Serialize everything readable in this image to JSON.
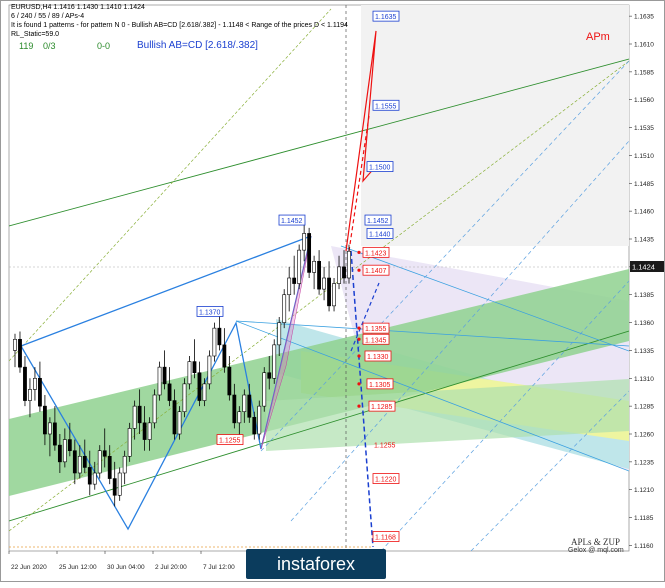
{
  "header": {
    "symbol_line": "EURUSD,H4  1.1416 1.1430 1.1410 1.1424",
    "indicator_line": "6 / 240 / 55 / 89 / APs-4",
    "pattern_line": "It is found 1 patterns  -  for pattern N 0 - Bullish AB=CD [2.618/.382] - 1.1148 < Range of the prices D < 1.1194",
    "static_line": "RL_Static=59.0",
    "count_a": "119",
    "count_b": "0/3",
    "count_c": "0-0",
    "pattern_name": "Bullish AB=CD [2.618/.382]"
  },
  "brand": {
    "apm": "APm",
    "credit_1": "APLs & ZUP",
    "credit_2": "Gelox @ mql.com",
    "watermark": "instaforex"
  },
  "price_axis": {
    "ticks": [
      "1.1635",
      "1.1610",
      "1.1585",
      "1.1560",
      "1.1535",
      "1.1510",
      "1.1485",
      "1.1460",
      "1.1435",
      "1.1410",
      "1.1385",
      "1.1360",
      "1.1335",
      "1.1310",
      "1.1285",
      "1.1260",
      "1.1235",
      "1.1210",
      "1.1185",
      "1.1160"
    ],
    "current": "1.1424"
  },
  "time_axis": {
    "ticks": [
      "22 Jun 2020",
      "25 Jun 12:00",
      "30 Jun 04:00",
      "2 Jul 20:00",
      "7 Jul 12:00"
    ]
  },
  "labels": {
    "blue": [
      "1.1635",
      "1.1555",
      "1.1500",
      "1.1452",
      "1.1440",
      "1.1452",
      "1.1370"
    ],
    "red": [
      "1.1423",
      "1.1407",
      "1.1355",
      "1.1345",
      "1.1330",
      "1.1305",
      "1.1285",
      "1.1220",
      "1.1168",
      "1.1255"
    ],
    "plain": [
      "1.1255"
    ]
  },
  "colors": {
    "accent_red": "#e11",
    "accent_blue": "#1a3fd0",
    "zone_green": "#5ab45a",
    "zone_yellow": "#f0f080",
    "zone_cyan": "#9fd8e0",
    "zone_lavender": "#ece6f6"
  },
  "chart_data": {
    "type": "candlestick",
    "title": "EURUSD,H4",
    "ylim": [
      1.1155,
      1.1645
    ],
    "x_range": [
      "22 Jun 2020",
      "7 Jul 12:00"
    ],
    "ohlc": [
      [
        1.1335,
        1.135,
        1.132,
        1.1345
      ],
      [
        1.1345,
        1.1352,
        1.1315,
        1.132
      ],
      [
        1.132,
        1.133,
        1.1285,
        1.129
      ],
      [
        1.129,
        1.131,
        1.1275,
        1.13
      ],
      [
        1.13,
        1.132,
        1.129,
        1.131
      ],
      [
        1.131,
        1.1325,
        1.128,
        1.1285
      ],
      [
        1.1285,
        1.1295,
        1.125,
        1.126
      ],
      [
        1.126,
        1.1275,
        1.124,
        1.127
      ],
      [
        1.127,
        1.1285,
        1.1245,
        1.125
      ],
      [
        1.125,
        1.126,
        1.1225,
        1.1235
      ],
      [
        1.1235,
        1.1265,
        1.123,
        1.1255
      ],
      [
        1.1255,
        1.127,
        1.124,
        1.1245
      ],
      [
        1.1245,
        1.1255,
        1.1215,
        1.1225
      ],
      [
        1.1225,
        1.125,
        1.122,
        1.124
      ],
      [
        1.124,
        1.1255,
        1.1225,
        1.123
      ],
      [
        1.123,
        1.1245,
        1.1205,
        1.1215
      ],
      [
        1.1215,
        1.1235,
        1.121,
        1.1225
      ],
      [
        1.1225,
        1.125,
        1.122,
        1.1245
      ],
      [
        1.1245,
        1.1265,
        1.123,
        1.124
      ],
      [
        1.124,
        1.125,
        1.1215,
        1.122
      ],
      [
        1.122,
        1.1235,
        1.1195,
        1.1205
      ],
      [
        1.1205,
        1.123,
        1.12,
        1.1225
      ],
      [
        1.1225,
        1.1245,
        1.1215,
        1.124
      ],
      [
        1.124,
        1.127,
        1.1235,
        1.1265
      ],
      [
        1.1265,
        1.129,
        1.1255,
        1.1285
      ],
      [
        1.1285,
        1.13,
        1.126,
        1.127
      ],
      [
        1.127,
        1.1285,
        1.1245,
        1.1255
      ],
      [
        1.1255,
        1.1275,
        1.1245,
        1.127
      ],
      [
        1.127,
        1.13,
        1.1265,
        1.1295
      ],
      [
        1.1295,
        1.1325,
        1.129,
        1.132
      ],
      [
        1.132,
        1.1335,
        1.13,
        1.1305
      ],
      [
        1.1305,
        1.132,
        1.1285,
        1.129
      ],
      [
        1.129,
        1.13,
        1.1255,
        1.126
      ],
      [
        1.126,
        1.1285,
        1.1255,
        1.128
      ],
      [
        1.128,
        1.131,
        1.1275,
        1.1305
      ],
      [
        1.1305,
        1.133,
        1.13,
        1.1325
      ],
      [
        1.1325,
        1.1345,
        1.131,
        1.1315
      ],
      [
        1.1315,
        1.1325,
        1.1285,
        1.129
      ],
      [
        1.129,
        1.131,
        1.1285,
        1.1305
      ],
      [
        1.1305,
        1.1335,
        1.13,
        1.133
      ],
      [
        1.133,
        1.136,
        1.1325,
        1.1355
      ],
      [
        1.1355,
        1.137,
        1.1335,
        1.134
      ],
      [
        1.134,
        1.1355,
        1.1315,
        1.132
      ],
      [
        1.132,
        1.133,
        1.129,
        1.1295
      ],
      [
        1.1295,
        1.1305,
        1.1265,
        1.127
      ],
      [
        1.127,
        1.1285,
        1.1255,
        1.128
      ],
      [
        1.128,
        1.13,
        1.127,
        1.1295
      ],
      [
        1.1295,
        1.1305,
        1.127,
        1.1275
      ],
      [
        1.1275,
        1.128,
        1.1255,
        1.126
      ],
      [
        1.126,
        1.129,
        1.1255,
        1.1285
      ],
      [
        1.1285,
        1.132,
        1.128,
        1.1315
      ],
      [
        1.1315,
        1.133,
        1.13,
        1.131
      ],
      [
        1.131,
        1.1345,
        1.1305,
        1.134
      ],
      [
        1.134,
        1.1365,
        1.133,
        1.136
      ],
      [
        1.136,
        1.139,
        1.1355,
        1.1385
      ],
      [
        1.1385,
        1.141,
        1.137,
        1.14
      ],
      [
        1.14,
        1.142,
        1.1385,
        1.1395
      ],
      [
        1.1395,
        1.143,
        1.139,
        1.1425
      ],
      [
        1.1425,
        1.1452,
        1.1415,
        1.144
      ],
      [
        1.144,
        1.1445,
        1.14,
        1.1405
      ],
      [
        1.1405,
        1.142,
        1.139,
        1.1415
      ],
      [
        1.1415,
        1.1425,
        1.1385,
        1.139
      ],
      [
        1.139,
        1.141,
        1.138,
        1.14
      ],
      [
        1.14,
        1.1415,
        1.137,
        1.1375
      ],
      [
        1.1375,
        1.14,
        1.137,
        1.1395
      ],
      [
        1.1395,
        1.142,
        1.139,
        1.141
      ],
      [
        1.141,
        1.1425,
        1.1395,
        1.14
      ],
      [
        1.14,
        1.143,
        1.1395,
        1.1424
      ]
    ]
  }
}
